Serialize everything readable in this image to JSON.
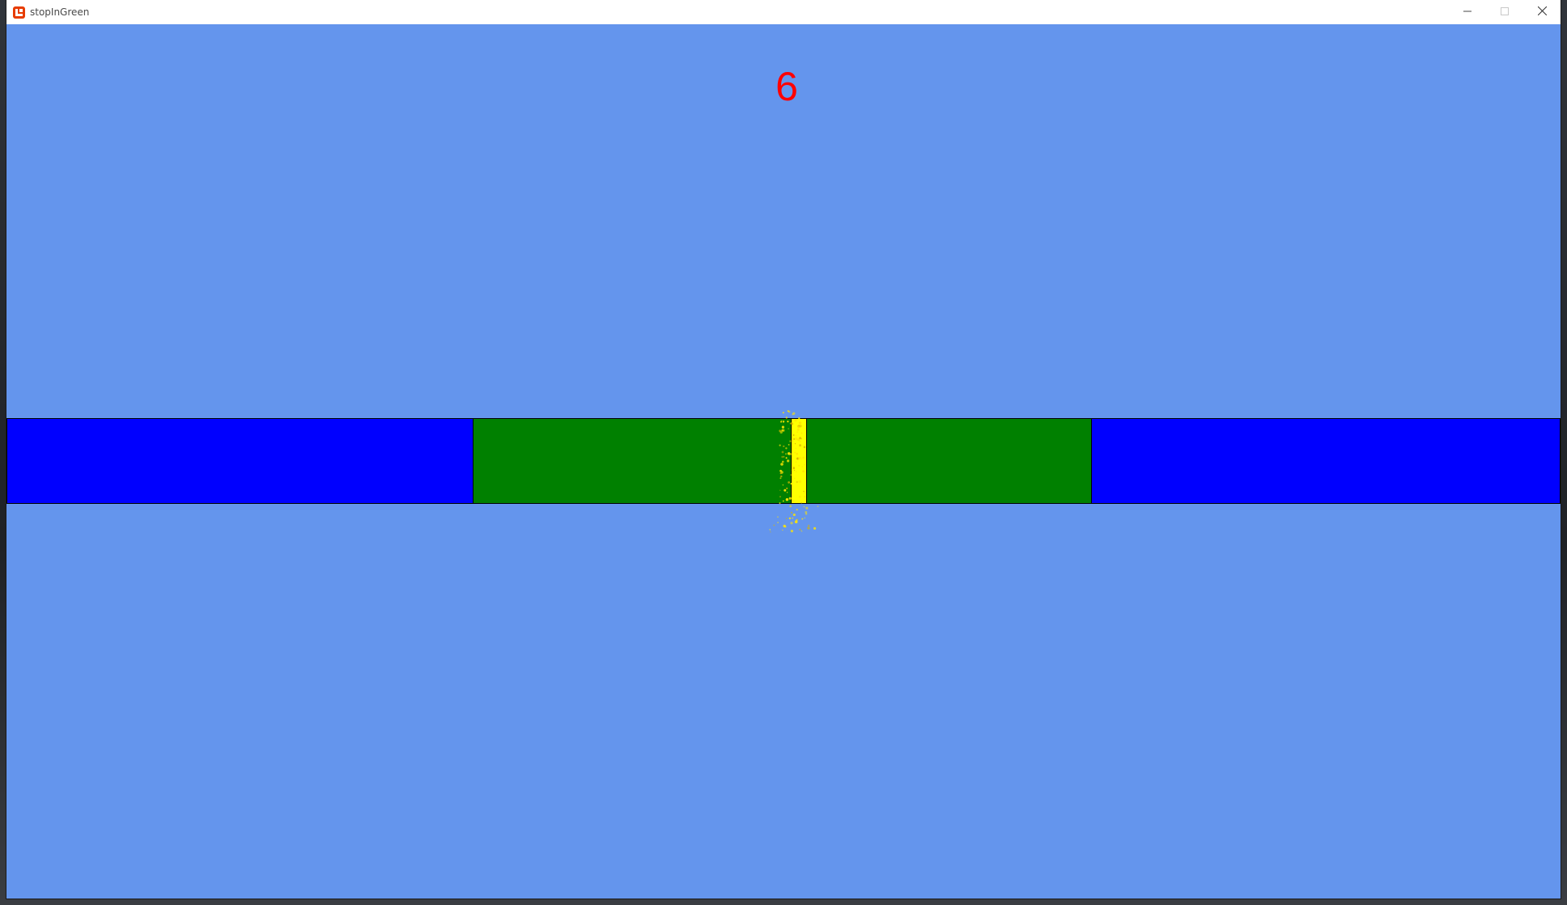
{
  "window": {
    "title": "stopInGreen"
  },
  "game": {
    "score": "6",
    "zones": [
      {
        "name": "left-miss-zone",
        "color": "#0000ff"
      },
      {
        "name": "center-target-zone",
        "color": "#008000"
      },
      {
        "name": "right-miss-zone",
        "color": "#0000ff"
      }
    ],
    "marker_color": "#ffff00",
    "marker_position": 0.51,
    "background_color": "#6495ed",
    "score_color": "#ff0000"
  },
  "icons": {
    "app": "monogame-icon",
    "minimize": "minimize-icon",
    "maximize": "maximize-icon",
    "close": "close-icon"
  }
}
